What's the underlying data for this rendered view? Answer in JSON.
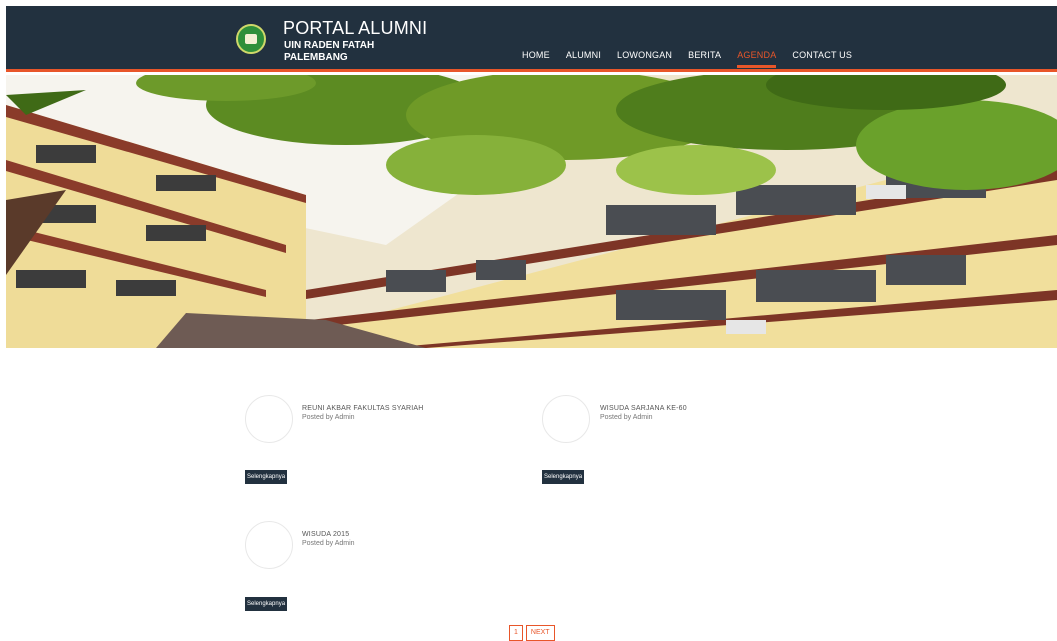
{
  "header": {
    "title": "PORTAL ALUMNI",
    "subtitle_line1": "UIN RADEN FATAH",
    "subtitle_line2": "PALEMBANG",
    "logo_icon": "university-emblem-icon"
  },
  "nav": {
    "items": [
      {
        "label": "HOME"
      },
      {
        "label": "ALUMNI"
      },
      {
        "label": "LOWONGAN"
      },
      {
        "label": "BERITA"
      },
      {
        "label": "AGENDA"
      },
      {
        "label": "CONTACT US"
      }
    ],
    "active": "AGENDA",
    "accent_color": "#e8562a"
  },
  "hero": {
    "description_icon": "campus-building-photo"
  },
  "posts": [
    {
      "title": "REUNI AKBAR FAKULTAS SYARIAH",
      "byline": "Posted by Admin",
      "button": "Selengkapnya"
    },
    {
      "title": "WISUDA SARJANA KE-60",
      "byline": "Posted by Admin",
      "button": "Selengkapnya"
    },
    {
      "title": "WISUDA 2015",
      "byline": "Posted by Admin",
      "button": "Selengkapnya"
    }
  ],
  "pagination": {
    "page": "1",
    "next": "NEXT"
  },
  "colors": {
    "header_bg": "#22313f",
    "accent": "#e8562a"
  }
}
